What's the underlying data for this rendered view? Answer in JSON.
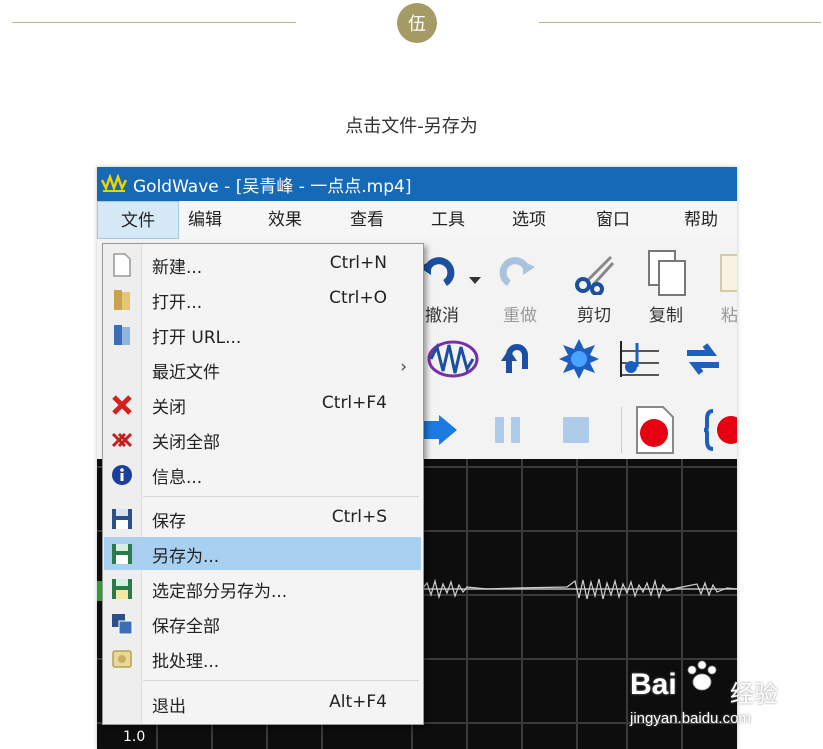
{
  "header": {
    "badge": "伍",
    "caption": "点击文件-另存为"
  },
  "window": {
    "title": "GoldWave - [吴青峰 - 一点点.mp4]"
  },
  "menubar": {
    "items": [
      "文件",
      "编辑",
      "效果",
      "查看",
      "工具",
      "选项",
      "窗口",
      "帮助"
    ],
    "active": "文件"
  },
  "toolbar": {
    "undo_label": "撤消",
    "redo_label": "重做",
    "cut_label": "剪切",
    "copy_label": "复制",
    "paste_label": "粘"
  },
  "file_menu": {
    "items": [
      {
        "label": "新建...",
        "shortcut": "Ctrl+N",
        "icon": "new-file-icon"
      },
      {
        "label": "打开...",
        "shortcut": "Ctrl+O",
        "icon": "open-icon"
      },
      {
        "label": "打开 URL...",
        "shortcut": "",
        "icon": "open-url-icon"
      },
      {
        "label": "最近文件",
        "shortcut": "",
        "icon": "",
        "submenu": true
      },
      {
        "label": "关闭",
        "shortcut": "Ctrl+F4",
        "icon": "close-icon"
      },
      {
        "label": "关闭全部",
        "shortcut": "",
        "icon": "close-all-icon"
      },
      {
        "label": "信息...",
        "shortcut": "",
        "icon": "info-icon"
      },
      {
        "label": "保存",
        "shortcut": "Ctrl+S",
        "icon": "save-icon"
      },
      {
        "label": "另存为...",
        "shortcut": "",
        "icon": "save-as-icon",
        "highlighted": true
      },
      {
        "label": "选定部分另存为...",
        "shortcut": "",
        "icon": "save-selection-icon"
      },
      {
        "label": "保存全部",
        "shortcut": "",
        "icon": "save-all-icon"
      },
      {
        "label": "批处理...",
        "shortcut": "",
        "icon": "batch-icon"
      },
      {
        "label": "退出",
        "shortcut": "Alt+F4",
        "icon": ""
      }
    ],
    "submenu_arrow": "›"
  },
  "waveform": {
    "axis_label": "1.0"
  },
  "watermark": {
    "brand": "Bai",
    "brand_cn": "经验",
    "url": "jingyan.baidu.com"
  },
  "colors": {
    "titlebar": "#1669b4",
    "highlight": "#a8d0f0",
    "badge": "#a59b64",
    "record": "#e60012"
  }
}
